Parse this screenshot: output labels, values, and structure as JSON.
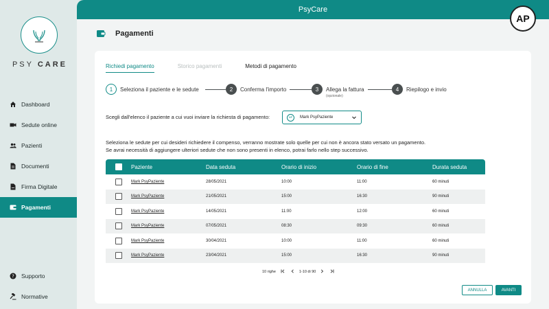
{
  "app": {
    "title": "PsyCare",
    "brand_light": "PSY",
    "brand_bold": "CARE",
    "avatar_initials": "AP"
  },
  "colors": {
    "accent": "#0f8a86",
    "sidebar_bg": "#dfe9e8"
  },
  "sidebar": {
    "items": [
      {
        "label": "Dashboard",
        "icon": "home-icon"
      },
      {
        "label": "Sedute online",
        "icon": "video-icon"
      },
      {
        "label": "Pazienti",
        "icon": "users-icon"
      },
      {
        "label": "Documenti",
        "icon": "document-icon"
      },
      {
        "label": "Firma Digitale",
        "icon": "signature-icon"
      },
      {
        "label": "Pagamenti",
        "icon": "wallet-icon",
        "active": true
      }
    ],
    "bottom_items": [
      {
        "label": "Supporto",
        "icon": "help-icon"
      },
      {
        "label": "Normative",
        "icon": "gavel-icon"
      }
    ]
  },
  "page": {
    "title": "Pagamenti"
  },
  "tabs": [
    {
      "label": "Richiedi pagamento",
      "state": "active"
    },
    {
      "label": "Storico pagamenti",
      "state": "disabled"
    },
    {
      "label": "Metodi di pagamento",
      "state": "normal"
    }
  ],
  "stepper": [
    {
      "num": "1",
      "label": "Seleziona il paziente e le sedute",
      "active": true
    },
    {
      "num": "2",
      "label": "Conferma l'importo"
    },
    {
      "num": "3",
      "label": "Allega la fattura",
      "sub": "(opzionale)"
    },
    {
      "num": "4",
      "label": "Riepilogo e invio"
    }
  ],
  "patient_select": {
    "prompt": "Scegli dall'elenco il paziente a cui vuoi inviare la richiesta di pagamento:",
    "value": "Mark PsyPaziente",
    "badge": "MP"
  },
  "info": {
    "line1": "Seleziona le sedute per cui desideri richiedere il compenso, verranno mostrate solo quelle per cui non è ancora stato versato un pagamento.",
    "line2": "Se avrai necessità di aggiungere ulteriori sedute che non sono presenti in elenco, potrai farlo nello step successivo."
  },
  "table": {
    "headers": [
      "Paziente",
      "Data seduta",
      "Orario di inizio",
      "Orario di fine",
      "Durata seduta"
    ],
    "rows": [
      [
        "Mark PsyPaziente",
        "28/05/2021",
        "10:00",
        "11:00",
        "60 minuti"
      ],
      [
        "Mark PsyPaziente",
        "21/05/2021",
        "15:00",
        "16:30",
        "90 minuti"
      ],
      [
        "Mark PsyPaziente",
        "14/05/2021",
        "11:00",
        "12:00",
        "60 minuti"
      ],
      [
        "Mark PsyPaziente",
        "07/05/2021",
        "08:30",
        "09:30",
        "60 minuti"
      ],
      [
        "Mark PsyPaziente",
        "30/04/2021",
        "10:00",
        "11:00",
        "60 minuti"
      ],
      [
        "Mark PsyPaziente",
        "23/04/2021",
        "15:00",
        "16:30",
        "90 minuti"
      ]
    ]
  },
  "pager": {
    "rows_per_page": "10 righe",
    "range": "1-10 di 90"
  },
  "buttons": {
    "cancel": "ANNULLA",
    "next": "AVANTI"
  }
}
